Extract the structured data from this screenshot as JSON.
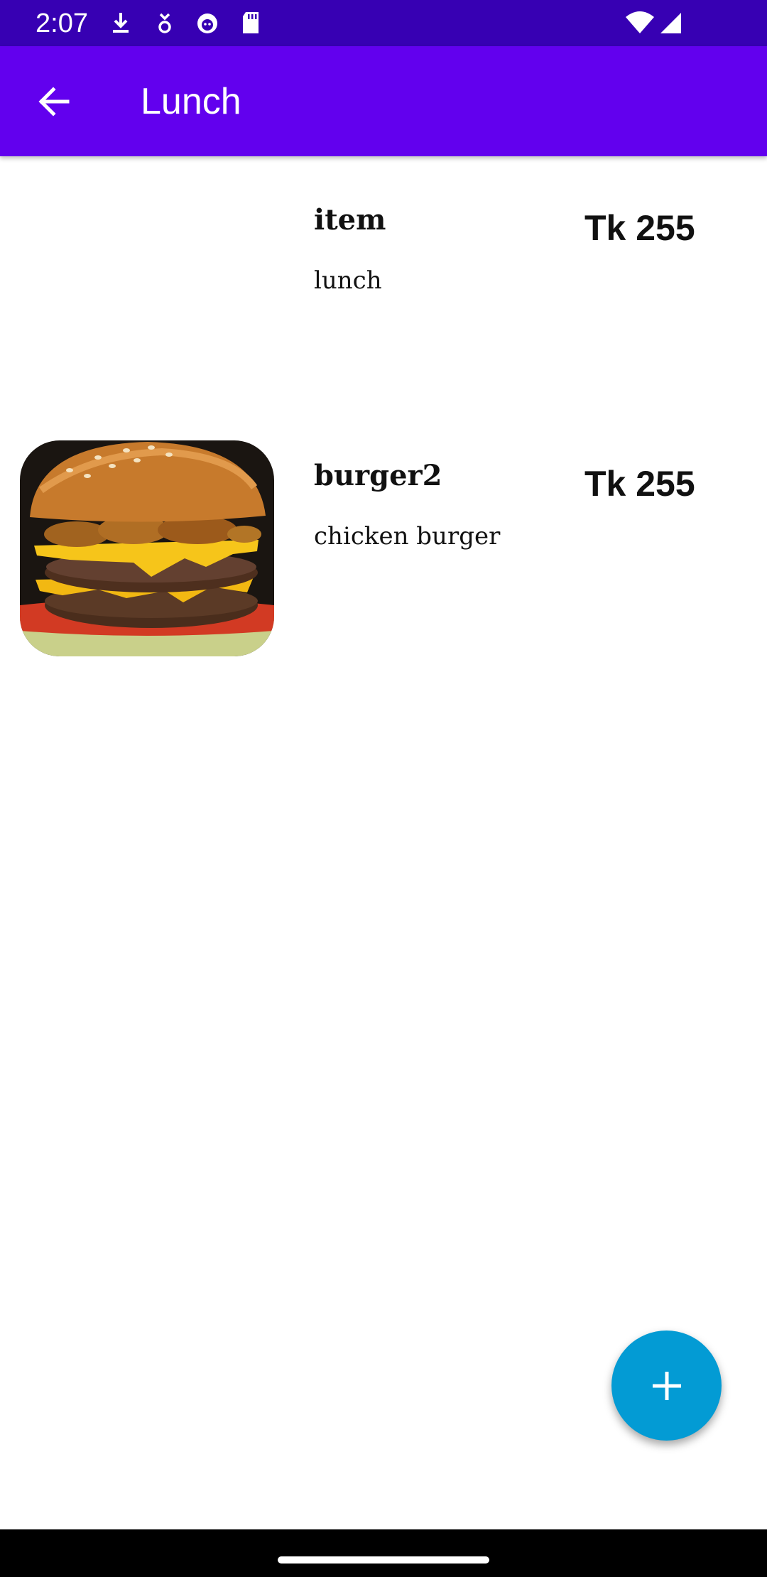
{
  "status_bar": {
    "time": "2:07",
    "icons": [
      "download-icon",
      "location-icon",
      "cat-icon",
      "sd-card-icon",
      "wifi-icon",
      "signal-icon"
    ]
  },
  "app_bar": {
    "title": "Lunch",
    "back_icon": "arrow-left-icon"
  },
  "items": [
    {
      "name": "item",
      "description": "lunch",
      "price": "Tk 255",
      "has_image": false
    },
    {
      "name": "burger2",
      "description": "chicken burger",
      "price": "Tk 255",
      "has_image": true,
      "image": "burger-photo"
    }
  ],
  "fab": {
    "icon": "plus-icon"
  },
  "colors": {
    "status_bar": "#3700B3",
    "app_bar": "#6200EE",
    "fab": "#039BD4"
  }
}
